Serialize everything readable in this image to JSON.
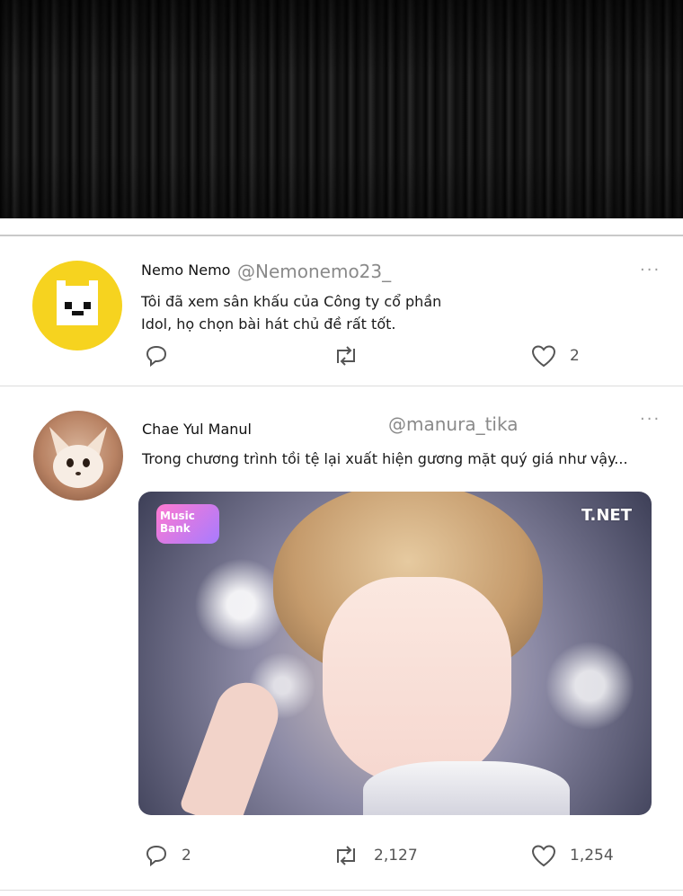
{
  "tweets": [
    {
      "name": "Nemo Nemo",
      "handle": "@Nemonemo23_",
      "text_line1": "Tôi đã xem sân khấu của Công ty cổ phần",
      "text_line2": "Idol, họ chọn bài hát chủ đề rất tốt.",
      "replies": "",
      "retweets": "",
      "likes": "2",
      "more": "···"
    },
    {
      "name": "Chae Yul Manul",
      "handle": "@manura_tika",
      "text": "Trong chương trình tồi tệ lại xuất hiện gương mặt quý giá như vậy...",
      "replies": "2",
      "retweets": "2,127",
      "likes": "1,254",
      "more": "···",
      "media": {
        "logo_text": "Music Bank",
        "watermark": "T.NET"
      }
    }
  ],
  "colors": {
    "avatar_yellow": "#f6d31f",
    "icon_gray": "#555555",
    "handle_gray": "#8a8a8a"
  },
  "icons": [
    "reply-icon",
    "retweet-icon",
    "like-icon",
    "more-icon"
  ]
}
